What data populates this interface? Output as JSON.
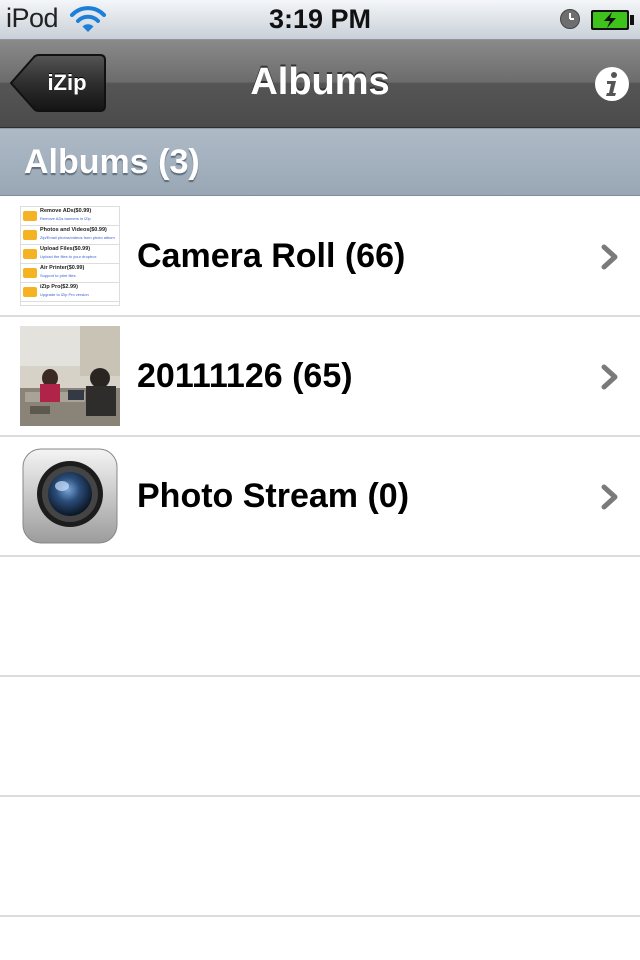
{
  "status_bar": {
    "carrier": "iPod",
    "time": "3:19 PM",
    "icons": [
      "wifi-icon",
      "alarm-clock-icon",
      "battery-charging-icon"
    ],
    "battery_color": "#3fc21b"
  },
  "nav_bar": {
    "back_label": "iZip",
    "title": "Albums",
    "info_icon": "info-icon"
  },
  "section": {
    "title": "Albums (3)"
  },
  "albums": [
    {
      "label": "Camera Roll (66)",
      "thumbnail": "screenshot-list-thumbnail",
      "thumb_items": [
        {
          "title": "Remove ADs($0.99)",
          "sub": "Remove ADs banners in iZip"
        },
        {
          "title": "Photos and Videos($0.99)",
          "sub": "Zip/Email photos/videos from photo album"
        },
        {
          "title": "Upload Files($0.99)",
          "sub": "Upload the files to your dropbox"
        },
        {
          "title": "Air Printer($0.99)",
          "sub": "Support to print files"
        },
        {
          "title": "iZip Pro($2.99)",
          "sub": "Upgrade to iZip Pro version"
        }
      ]
    },
    {
      "label": "20111126 (65)",
      "thumbnail": "photo-thumbnail"
    },
    {
      "label": "Photo Stream (0)",
      "thumbnail": "camera-lens-icon"
    }
  ],
  "colors": {
    "nav_bar": "#5a5a5a",
    "section_header": "#a3b0bd",
    "row_divider": "#dcdcdc",
    "chevron": "#7a7a7a"
  }
}
